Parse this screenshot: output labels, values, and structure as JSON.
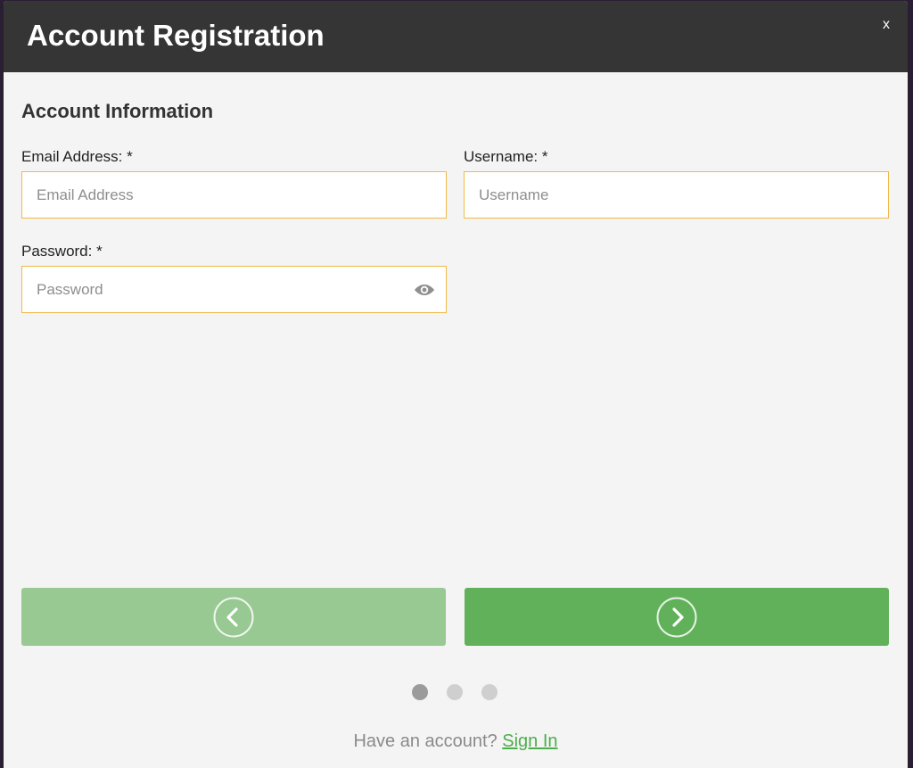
{
  "modal": {
    "title": "Account Registration",
    "close_label": "x"
  },
  "section": {
    "title": "Account Information"
  },
  "fields": {
    "email": {
      "label": "Email Address: *",
      "placeholder": "Email Address",
      "value": ""
    },
    "username": {
      "label": "Username: *",
      "placeholder": "Username",
      "value": ""
    },
    "password": {
      "label": "Password: *",
      "placeholder": "Password",
      "value": "",
      "toggle_icon": "eye-icon"
    }
  },
  "navigation": {
    "prev_icon": "chevron-left-icon",
    "next_icon": "chevron-right-icon",
    "prev_color": "#98c992",
    "next_color": "#61b15a"
  },
  "pagination": {
    "total_steps": 3,
    "current_step": 1,
    "active_color": "#9b9b9b",
    "inactive_color": "#cfcfcf"
  },
  "footer": {
    "prompt": "Have an account?",
    "link_label": "Sign In"
  }
}
